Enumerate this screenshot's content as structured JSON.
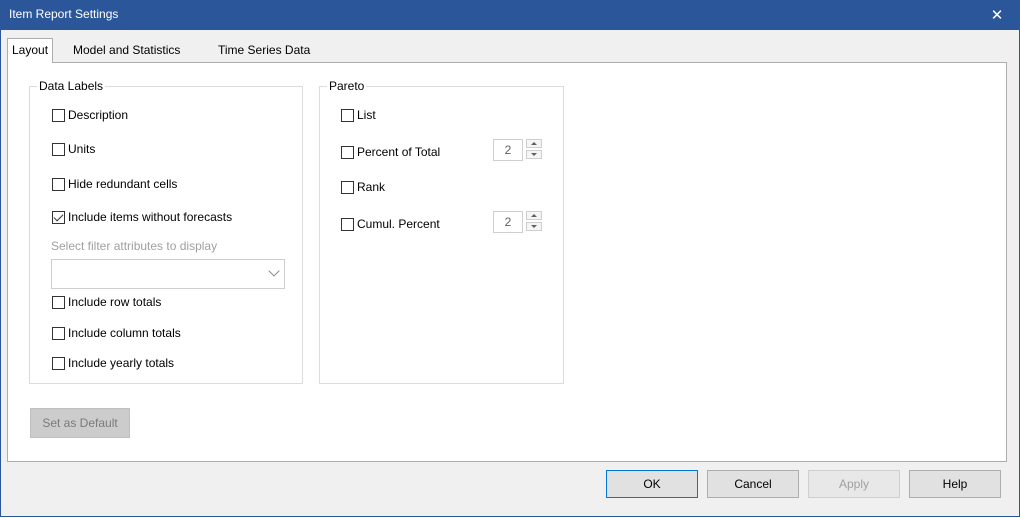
{
  "window": {
    "title": "Item Report Settings",
    "close_glyph": "✕"
  },
  "tabs": [
    {
      "label": "Layout",
      "active": true
    },
    {
      "label": "Model and Statistics",
      "active": false
    },
    {
      "label": "Time Series Data",
      "active": false
    }
  ],
  "data_labels": {
    "legend": "Data Labels",
    "description": {
      "label": "Description",
      "checked": false
    },
    "units": {
      "label": "Units",
      "checked": false
    },
    "hide_redundant": {
      "label": "Hide redundant cells",
      "checked": false
    },
    "include_items": {
      "label": "Include items without forecasts",
      "checked": true
    },
    "filter_hint": "Select filter attributes to display",
    "filter_value": "",
    "row_totals": {
      "label": "Include row totals",
      "checked": false
    },
    "column_totals": {
      "label": "Include column totals",
      "checked": false
    },
    "yearly_totals": {
      "label": "Include yearly totals",
      "checked": false
    }
  },
  "pareto": {
    "legend": "Pareto",
    "list": {
      "label": "List",
      "checked": false
    },
    "percent_of_total": {
      "label": "Percent of Total",
      "checked": false,
      "value": "2"
    },
    "rank": {
      "label": "Rank",
      "checked": false
    },
    "cumul_percent": {
      "label": "Cumul. Percent",
      "checked": false,
      "value": "2"
    }
  },
  "buttons": {
    "set_default": "Set as Default",
    "ok": "OK",
    "cancel": "Cancel",
    "apply": "Apply",
    "help": "Help"
  },
  "colors": {
    "titlebar": "#2b579a",
    "dialog_bg": "#f0f0f0"
  }
}
